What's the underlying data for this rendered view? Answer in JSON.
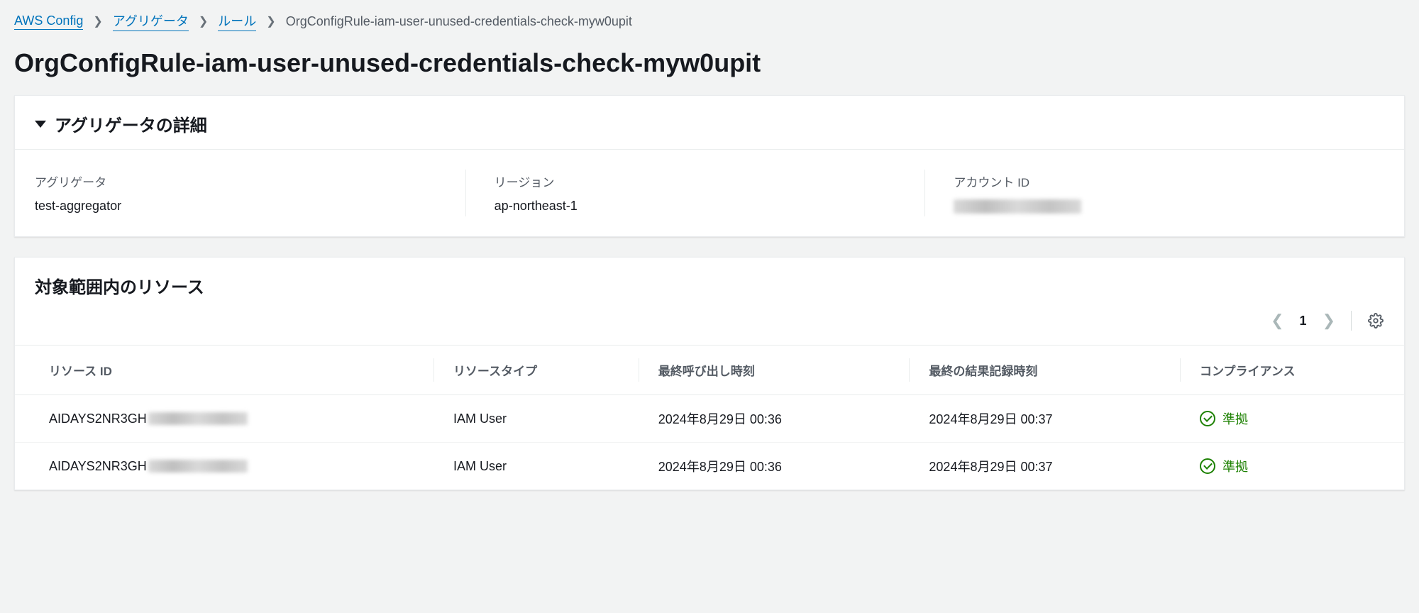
{
  "breadcrumb": {
    "items": [
      {
        "label": "AWS Config",
        "link": true
      },
      {
        "label": "アグリゲータ",
        "link": true
      },
      {
        "label": "ルール",
        "link": true
      },
      {
        "label": "OrgConfigRule-iam-user-unused-credentials-check-myw0upit",
        "link": false
      }
    ]
  },
  "page_title": "OrgConfigRule-iam-user-unused-credentials-check-myw0upit",
  "aggregator_panel": {
    "header": "アグリゲータの詳細",
    "fields": {
      "aggregator_label": "アグリゲータ",
      "aggregator_value": "test-aggregator",
      "region_label": "リージョン",
      "region_value": "ap-northeast-1",
      "account_label": "アカウント ID",
      "account_value": ""
    }
  },
  "resources_panel": {
    "header": "対象範囲内のリソース",
    "columns": {
      "resource_id": "リソース ID",
      "resource_type": "リソースタイプ",
      "last_invoked": "最終呼び出し時刻",
      "last_recorded": "最終の結果記録時刻",
      "compliance": "コンプライアンス"
    },
    "rows": [
      {
        "resource_id_prefix": "AIDAYS2NR3GH",
        "resource_type": "IAM User",
        "last_invoked": "2024年8月29日 00:36",
        "last_recorded": "2024年8月29日 00:37",
        "compliance": "準拠"
      },
      {
        "resource_id_prefix": "AIDAYS2NR3GH",
        "resource_type": "IAM User",
        "last_invoked": "2024年8月29日 00:36",
        "last_recorded": "2024年8月29日 00:37",
        "compliance": "準拠"
      }
    ],
    "pagination": {
      "current_page": "1"
    }
  }
}
